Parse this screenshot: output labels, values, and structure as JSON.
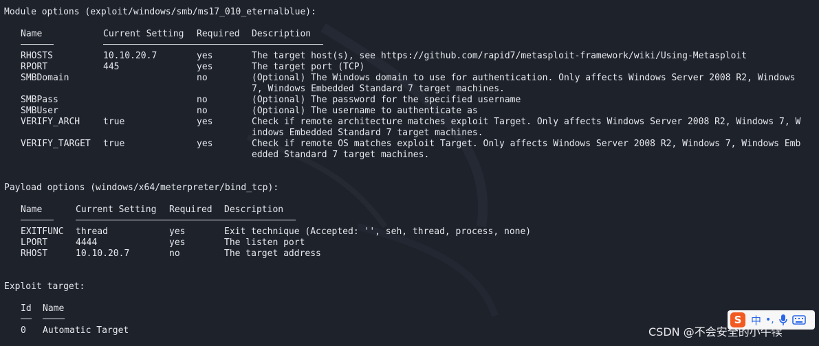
{
  "terminal": {
    "module_header": "Module options (exploit/windows/smb/ms17_010_eternalblue):",
    "module_table": {
      "headers": [
        "Name",
        "Current Setting",
        "Required",
        "Description"
      ],
      "rows": [
        {
          "name": "RHOSTS",
          "setting": "10.10.20.7",
          "required": "yes",
          "desc": [
            "The target host(s), see https://github.com/rapid7/metasploit-framework/wiki/Using-Metasploit"
          ]
        },
        {
          "name": "RPORT",
          "setting": "445",
          "required": "yes",
          "desc": [
            "The target port (TCP)"
          ]
        },
        {
          "name": "SMBDomain",
          "setting": "",
          "required": "no",
          "desc": [
            "(Optional) The Windows domain to use for authentication. Only affects Windows Server 2008 R2, Windows",
            "7, Windows Embedded Standard 7 target machines."
          ]
        },
        {
          "name": "SMBPass",
          "setting": "",
          "required": "no",
          "desc": [
            "(Optional) The password for the specified username"
          ]
        },
        {
          "name": "SMBUser",
          "setting": "",
          "required": "no",
          "desc": [
            "(Optional) The username to authenticate as"
          ]
        },
        {
          "name": "VERIFY_ARCH",
          "setting": "true",
          "required": "yes",
          "desc": [
            "Check if remote architecture matches exploit Target. Only affects Windows Server 2008 R2, Windows 7, W",
            "indows Embedded Standard 7 target machines."
          ]
        },
        {
          "name": "VERIFY_TARGET",
          "setting": "true",
          "required": "yes",
          "desc": [
            "Check if remote OS matches exploit Target. Only affects Windows Server 2008 R2, Windows 7, Windows Emb",
            "edded Standard 7 target machines."
          ]
        }
      ]
    },
    "payload_header": "Payload options (windows/x64/meterpreter/bind_tcp):",
    "payload_table": {
      "headers": [
        "Name",
        "Current Setting",
        "Required",
        "Description"
      ],
      "rows": [
        {
          "name": "EXITFUNC",
          "setting": "thread",
          "required": "yes",
          "desc": [
            "Exit technique (Accepted: '', seh, thread, process, none)"
          ]
        },
        {
          "name": "LPORT",
          "setting": "4444",
          "required": "yes",
          "desc": [
            "The listen port"
          ]
        },
        {
          "name": "RHOST",
          "setting": "10.10.20.7",
          "required": "no",
          "desc": [
            "The target address"
          ]
        }
      ]
    },
    "target_header": "Exploit target:",
    "target_table": {
      "headers": [
        "Id",
        "Name"
      ],
      "rows": [
        {
          "id": "0",
          "name": "Automatic Target"
        }
      ]
    }
  },
  "watermark": "CSDN @不会安全的小牛犊",
  "ime_bar": {
    "lang": "中",
    "punct": "•,",
    "icons": [
      "sogou-logo-icon",
      "microphone-icon",
      "keyboard-icon"
    ]
  },
  "colors": {
    "background": "#1e222b",
    "text": "#e7e9ee",
    "ime_accent": "#2a66e8",
    "ime_logo": "#f25a22"
  }
}
